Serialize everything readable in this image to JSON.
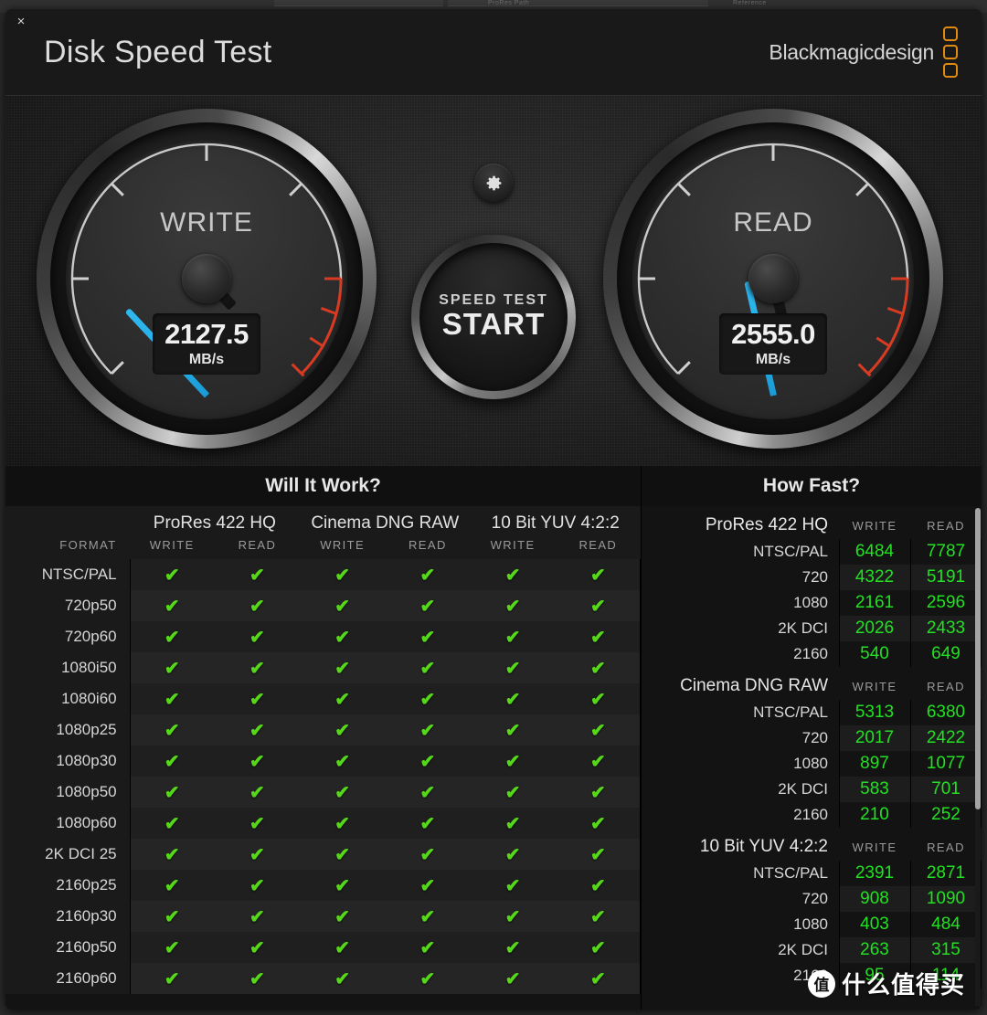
{
  "desktop": {
    "bg_label_1": "ProRes Path",
    "bg_label_2": "Reference"
  },
  "window": {
    "close_label": "×",
    "title": "Disk Speed Test",
    "brand": "Blackmagicdesign"
  },
  "gauges": {
    "write": {
      "label": "WRITE",
      "value": "2127.5",
      "unit": "MB/s",
      "angle": -43
    },
    "read": {
      "label": "READ",
      "value": "2555.0",
      "unit": "MB/s",
      "angle": -13
    },
    "gear_icon": "gear-icon",
    "start": {
      "sub_label": "SPEED TEST",
      "main_label": "START"
    }
  },
  "will_it_work": {
    "title": "Will It Work?",
    "format_header": "FORMAT",
    "groups": [
      {
        "name": "ProRes 422 HQ",
        "cols": [
          "WRITE",
          "READ"
        ]
      },
      {
        "name": "Cinema DNG RAW",
        "cols": [
          "WRITE",
          "READ"
        ]
      },
      {
        "name": "10 Bit YUV 4:2:2",
        "cols": [
          "WRITE",
          "READ"
        ]
      }
    ],
    "check_glyph": "✔",
    "rows": [
      {
        "format": "NTSC/PAL",
        "cells": [
          true,
          true,
          true,
          true,
          true,
          true
        ]
      },
      {
        "format": "720p50",
        "cells": [
          true,
          true,
          true,
          true,
          true,
          true
        ]
      },
      {
        "format": "720p60",
        "cells": [
          true,
          true,
          true,
          true,
          true,
          true
        ]
      },
      {
        "format": "1080i50",
        "cells": [
          true,
          true,
          true,
          true,
          true,
          true
        ]
      },
      {
        "format": "1080i60",
        "cells": [
          true,
          true,
          true,
          true,
          true,
          true
        ]
      },
      {
        "format": "1080p25",
        "cells": [
          true,
          true,
          true,
          true,
          true,
          true
        ]
      },
      {
        "format": "1080p30",
        "cells": [
          true,
          true,
          true,
          true,
          true,
          true
        ]
      },
      {
        "format": "1080p50",
        "cells": [
          true,
          true,
          true,
          true,
          true,
          true
        ]
      },
      {
        "format": "1080p60",
        "cells": [
          true,
          true,
          true,
          true,
          true,
          true
        ]
      },
      {
        "format": "2K DCI 25",
        "cells": [
          true,
          true,
          true,
          true,
          true,
          true
        ]
      },
      {
        "format": "2160p25",
        "cells": [
          true,
          true,
          true,
          true,
          true,
          true
        ]
      },
      {
        "format": "2160p30",
        "cells": [
          true,
          true,
          true,
          true,
          true,
          true
        ]
      },
      {
        "format": "2160p50",
        "cells": [
          true,
          true,
          true,
          true,
          true,
          true
        ]
      },
      {
        "format": "2160p60",
        "cells": [
          true,
          true,
          true,
          true,
          true,
          true
        ]
      }
    ]
  },
  "how_fast": {
    "title": "How Fast?",
    "col_write": "WRITE",
    "col_read": "READ",
    "sections": [
      {
        "name": "ProRes 422 HQ",
        "rows": [
          {
            "res": "NTSC/PAL",
            "write": "6484",
            "read": "7787"
          },
          {
            "res": "720",
            "write": "4322",
            "read": "5191"
          },
          {
            "res": "1080",
            "write": "2161",
            "read": "2596"
          },
          {
            "res": "2K DCI",
            "write": "2026",
            "read": "2433"
          },
          {
            "res": "2160",
            "write": "540",
            "read": "649"
          }
        ]
      },
      {
        "name": "Cinema DNG RAW",
        "rows": [
          {
            "res": "NTSC/PAL",
            "write": "5313",
            "read": "6380"
          },
          {
            "res": "720",
            "write": "2017",
            "read": "2422"
          },
          {
            "res": "1080",
            "write": "897",
            "read": "1077"
          },
          {
            "res": "2K DCI",
            "write": "583",
            "read": "701"
          },
          {
            "res": "2160",
            "write": "210",
            "read": "252"
          }
        ]
      },
      {
        "name": "10 Bit YUV 4:2:2",
        "rows": [
          {
            "res": "NTSC/PAL",
            "write": "2391",
            "read": "2871"
          },
          {
            "res": "720",
            "write": "908",
            "read": "1090"
          },
          {
            "res": "1080",
            "write": "403",
            "read": "484"
          },
          {
            "res": "2K DCI",
            "write": "263",
            "read": "315"
          },
          {
            "res": "2160",
            "write": "95",
            "read": "114"
          }
        ]
      }
    ]
  },
  "watermark": {
    "badge": "值",
    "text": "什么值得买"
  },
  "colors": {
    "needle": "#22a9e4",
    "check_green": "#56d71a",
    "value_green": "#22e022",
    "brand_orange": "#e08a12",
    "redzone": "#d93b22"
  }
}
